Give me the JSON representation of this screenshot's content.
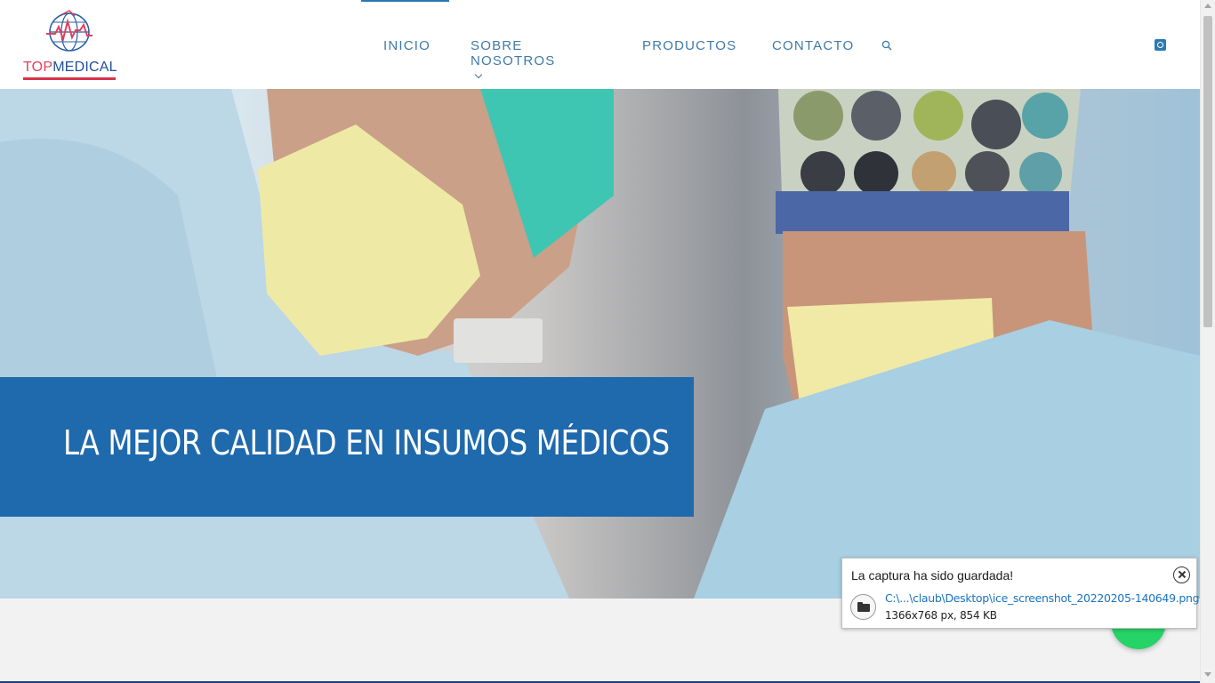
{
  "header": {
    "logo": {
      "part1": "TOP",
      "part2": "MEDICAL"
    },
    "nav": [
      {
        "label": "INICIO",
        "active": true
      },
      {
        "label": "SOBRE NOSOTROS",
        "has_dropdown": true
      },
      {
        "label": "PRODUCTOS"
      },
      {
        "label": "CONTACTO"
      }
    ],
    "icons": [
      "search-icon",
      "square-icon"
    ]
  },
  "hero": {
    "headline": "LA MEJOR CALIDAD EN INSUMOS MÉDICOS",
    "banner_color": "#1f69ad"
  },
  "toast": {
    "title": "La captura ha sido guardada!",
    "path": "C:\\...\\claub\\Desktop\\ice_screenshot_20220205-140649.png",
    "info": "1366x768 px, 854 KB"
  },
  "colors": {
    "accent": "#2a78b3",
    "nav_text": "#3e7aa6",
    "logo_red": "#e0415a",
    "logo_blue": "#1f4f9a",
    "whatsapp": "#25d366"
  }
}
